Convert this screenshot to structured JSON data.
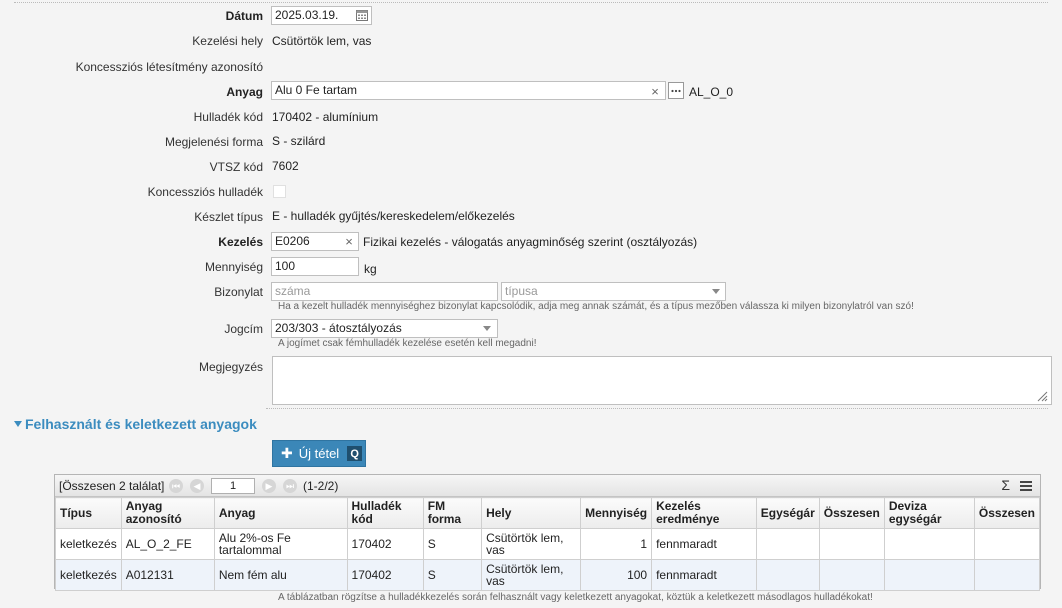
{
  "form": {
    "datum": {
      "label": "Dátum",
      "value": "2025.03.19."
    },
    "kezelesi_hely": {
      "label": "Kezelési hely",
      "value": "Csütörtök lem, vas"
    },
    "koncesszios_letesitmeny": {
      "label": "Koncessziós létesítmény azonosító",
      "value": ""
    },
    "anyag": {
      "label": "Anyag",
      "value": "Alu 0 Fe tartam",
      "code": "AL_O_0"
    },
    "hulladek_kod": {
      "label": "Hulladék kód",
      "value": "170402 - alumínium"
    },
    "megjelenesi_forma": {
      "label": "Megjelenési forma",
      "value": "S - szilárd"
    },
    "vtsz_kod": {
      "label": "VTSZ kód",
      "value": "7602"
    },
    "koncesszios_hulladek": {
      "label": "Koncessziós hulladék",
      "checked": false
    },
    "keszlet_tipus": {
      "label": "Készlet típus",
      "value": "E - hulladék gyűjtés/kereskedelem/előkezelés"
    },
    "kezeles": {
      "label": "Kezelés",
      "value": "E0206",
      "description": "Fizikai kezelés - válogatás anyagminőség szerint (osztályozás)"
    },
    "mennyiseg": {
      "label": "Mennyiség",
      "value": "100",
      "unit": "kg"
    },
    "bizonylat": {
      "label": "Bizonylat",
      "szama_placeholder": "száma",
      "tipusa_placeholder": "típusa",
      "hint": "Ha a kezelt hulladék mennyiséghez bizonylat kapcsolódik, adja meg annak számát, és a típus mezőben válassza ki milyen bizonylatról van szó!"
    },
    "jogcim": {
      "label": "Jogcím",
      "value": "203/303 - átosztályozás",
      "hint": "A jogímet csak fémhulladék kezelése esetén kell megadni!"
    },
    "megjegyzes": {
      "label": "Megjegyzés",
      "value": ""
    }
  },
  "section": {
    "title": "Felhasznált és keletkezett anyagok",
    "new_button": "Új tétel",
    "new_button_shortcut": "Q"
  },
  "grid": {
    "total": "[Összesen 2 találat]",
    "page": "1",
    "range": "(1-2/2)",
    "sum_icon": "Σ",
    "columns": [
      "Típus",
      "Anyag azonosító",
      "Anyag",
      "Hulladék kód",
      "FM forma",
      "Hely",
      "Mennyiség",
      "Kezelés eredménye",
      "Egységár",
      "Összesen",
      "Deviza egységár",
      "Összesen"
    ],
    "rows": [
      [
        "keletkezés",
        "AL_O_2_FE",
        "Alu 2%-os Fe tartalommal",
        "170402",
        "S",
        "Csütörtök lem, vas",
        "1",
        "fennmaradt",
        "",
        "",
        "",
        ""
      ],
      [
        "keletkezés",
        "A012131",
        "Nem fém alu",
        "170402",
        "S",
        "Csütörtök lem, vas",
        "100",
        "fennmaradt",
        "",
        "",
        "",
        ""
      ]
    ],
    "footnote": "A táblázatban rögzítse a hulladékkezelés során felhasznált vagy keletkezett anyagokat, köztük a keletkezett másodlagos hulladékokat!"
  },
  "icons": {
    "calendar": "calendar-icon",
    "clear": "clear-icon",
    "ellipsis": "ellipsis-icon",
    "dropdown": "chevron-down-icon",
    "resize": "resize-handle-icon"
  },
  "colors": {
    "accent": "#3b87b8",
    "section_title": "#3b8cbf",
    "alt_row": "#eef3fa"
  }
}
